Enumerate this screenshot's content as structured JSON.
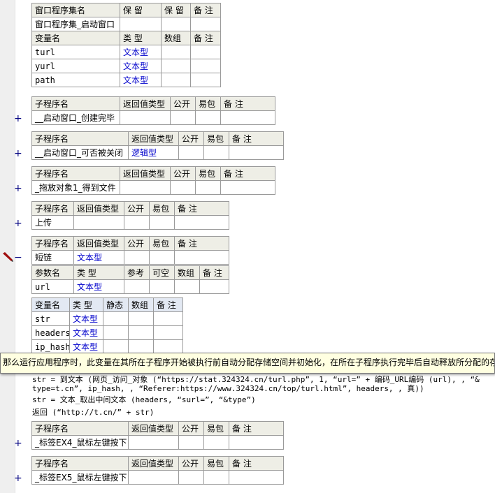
{
  "assembly": {
    "header": [
      "窗口程序集名",
      "保 留",
      "保 留",
      "备 注"
    ],
    "name": "窗口程序集_启动窗口",
    "var_header": [
      "变量名",
      "类 型",
      "数组",
      "备 注"
    ],
    "vars": [
      {
        "name": "turl",
        "type": "文本型"
      },
      {
        "name": "yurl",
        "type": "文本型"
      },
      {
        "name": "path",
        "type": "文本型"
      }
    ]
  },
  "sub_header_a": [
    "子程序名",
    "返回值类型",
    "公开",
    "易包",
    "备 注"
  ],
  "subs": [
    {
      "name": "__启动窗口_创建完毕",
      "ret": "",
      "marker": "+"
    },
    {
      "name": "__启动窗口_可否被关闭",
      "ret": "逻辑型",
      "marker": "+"
    },
    {
      "name": "_拖放对象1_得到文件",
      "ret": "",
      "marker": "+"
    },
    {
      "name": "上传",
      "ret": "",
      "marker": "+"
    }
  ],
  "short_sub": {
    "name": "短链",
    "ret": "文本型",
    "marker": "−",
    "param_header": [
      "参数名",
      "类 型",
      "参考",
      "可空",
      "数组",
      "备 注"
    ],
    "params": [
      {
        "name": "url",
        "type": "文本型"
      }
    ],
    "local_header": [
      "变量名",
      "类 型",
      "静态",
      "数组",
      "备 注"
    ],
    "locals": [
      {
        "name": "str",
        "type": "文本型"
      },
      {
        "name": "headers",
        "type": "文本型"
      },
      {
        "name": "ip_hash",
        "type": "文本型"
      }
    ]
  },
  "tooltip": "那么运行应用程序时，此变量在其所在子程序开始被执行前自动分配存储空间并初始化，在所在子程序执行完毕后自动释放所分配的存",
  "code": {
    "line1": "str  = 到文本 (网页_访问_对象 (“https://stat.324324.cn/turl.php”, 1, “url=” + 编码_URL编码 (url), , “&",
    "line2": "type=t.cn”, ip_hash, , “Referer:https://www.324324.cn/top/turl.html”, headers, , 真))",
    "line3": "str = 文本_取出中间文本 (headers, “surl=”, “&type”)",
    "line4": "返回 (“http://t.cn/” + str)"
  },
  "subs_bottom": [
    {
      "name": "_标签EX4_鼠标左键按下",
      "ret": "",
      "marker": "+"
    },
    {
      "name": "_标签EX5_鼠标左键按下",
      "ret": "",
      "marker": "+"
    }
  ]
}
